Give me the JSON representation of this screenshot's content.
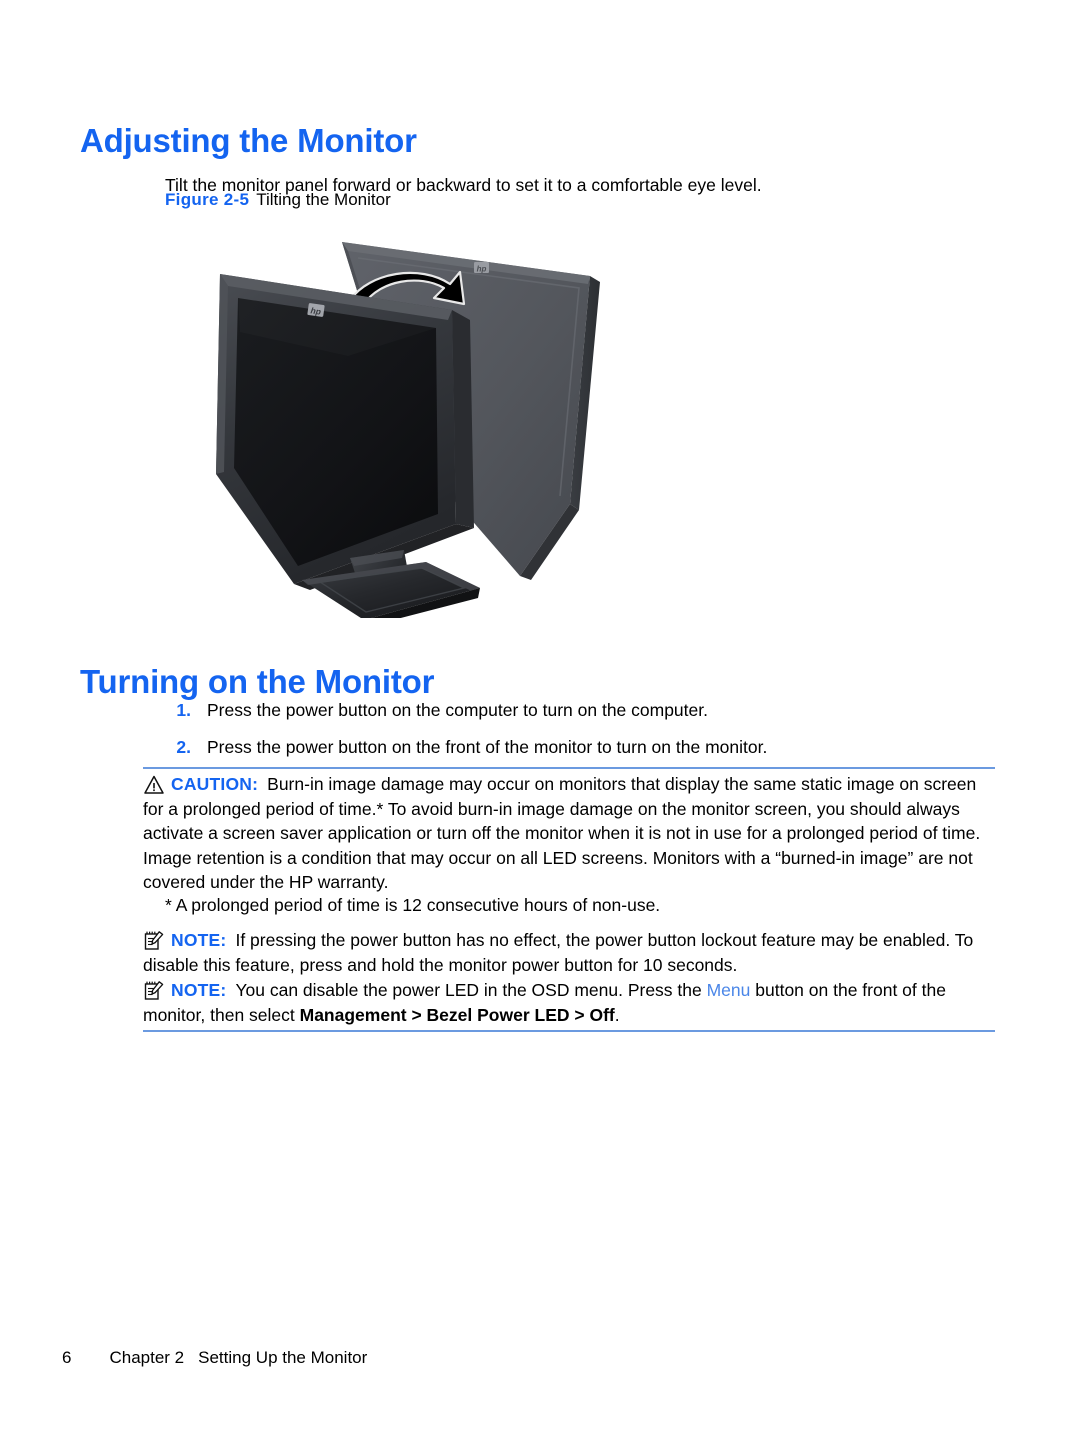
{
  "colors": {
    "heading_blue": "#1464f0",
    "rule_blue": "#6b9ae0",
    "link_blue": "#4a86e8",
    "body_black": "#000000"
  },
  "sections": {
    "adjusting": {
      "heading": "Adjusting the Monitor",
      "paragraph": "Tilt the monitor panel forward or backward to set it to a comfortable eye level.",
      "figure": {
        "label": "Figure 2-5",
        "title": "Tilting the Monitor",
        "alt": "Illustration of an HP flat panel monitor shown in two tilt positions with a curved double-headed arrow indicating forward and backward tilt"
      }
    },
    "turning_on": {
      "heading": "Turning on the Monitor",
      "steps": [
        {
          "num": "1.",
          "text": "Press the power button on the computer to turn on the computer."
        },
        {
          "num": "2.",
          "text": "Press the power button on the front of the monitor to turn on the monitor."
        }
      ]
    }
  },
  "admonitions": {
    "caution": {
      "icon": "warning-triangle-icon",
      "label": "CAUTION:",
      "text": "Burn-in image damage may occur on monitors that display the same static image on screen for a prolonged period of time.* To avoid burn-in image damage on the monitor screen, you should always activate a screen saver application or turn off the monitor when it is not in use for a prolonged period of time. Image retention is a condition that may occur on all LED screens. Monitors with a “burned-in image” are not covered under the HP warranty."
    },
    "footnote": "* A prolonged period of time is 12 consecutive hours of non-use.",
    "note_1": {
      "icon": "note-pencil-icon",
      "label": "NOTE:",
      "text": "If pressing the power button has no effect, the power button lockout feature may be enabled. To disable this feature, press and hold the monitor power button for 10 seconds."
    },
    "note_2": {
      "icon": "note-pencil-icon",
      "label": "NOTE:",
      "text_part_1": "You can disable the power LED in the OSD menu. Press the ",
      "menu_link": "Menu",
      "text_part_2": " button on the front of the monitor, then select ",
      "path_1": "Management",
      "path_sep_1": " > ",
      "path_2": "Bezel Power LED",
      "path_sep_2": " > ",
      "path_3": "Off",
      "text_part_3": "."
    }
  },
  "footer": {
    "page_number": "6",
    "chapter": "Chapter 2",
    "chapter_title": "Setting Up the Monitor"
  }
}
